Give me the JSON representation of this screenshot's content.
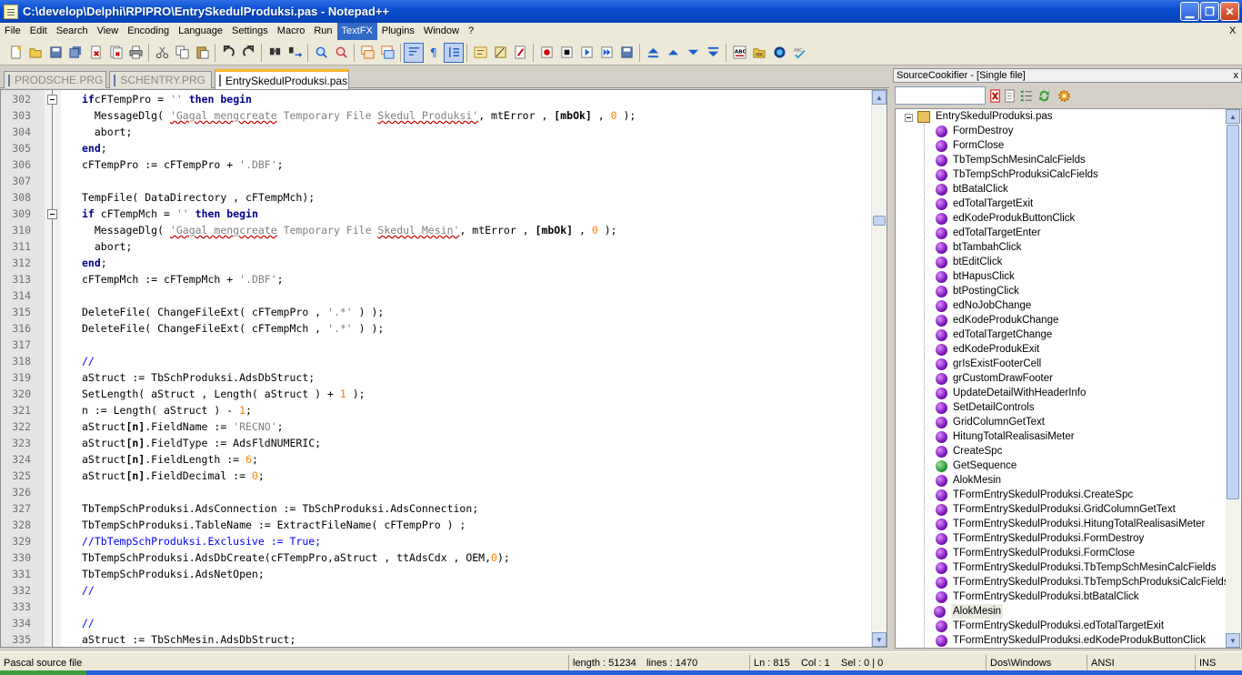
{
  "window": {
    "title": "C:\\develop\\Delphi\\RPIPRO\\EntrySkedulProduksi.pas - Notepad++",
    "minimize_glyph": "▁",
    "restore_glyph": "❐",
    "close_glyph": "✕"
  },
  "menu": {
    "items": [
      "File",
      "Edit",
      "Search",
      "View",
      "Encoding",
      "Language",
      "Settings",
      "Macro",
      "Run",
      "TextFX",
      "Plugins",
      "Window",
      "?"
    ],
    "active": "TextFX",
    "close_glyph": "X"
  },
  "toolbar": {
    "icons": [
      "new-file-icon",
      "open-file-icon",
      "save-icon",
      "save-all-icon",
      "close-icon",
      "close-all-icon",
      "print-icon",
      "cut-icon",
      "copy-icon",
      "paste-icon",
      "undo-icon",
      "redo-icon",
      "find-icon",
      "replace-icon",
      "zoom-in-icon",
      "zoom-out-icon",
      "sync-vertical-icon",
      "sync-horizontal-icon",
      "word-wrap-icon",
      "show-all-chars-icon",
      "indent-guide-icon",
      "user-lang-icon",
      "doc-map-icon",
      "function-list-icon",
      "record-macro-icon",
      "stop-macro-icon",
      "play-macro-icon",
      "run-macro-multiple-icon",
      "save-macro-icon",
      "bookmark-first-icon",
      "bookmark-prev-icon",
      "bookmark-next-icon",
      "bookmark-last-icon",
      "spell-check-icon",
      "spell-options-icon",
      "source-cookifier-icon",
      "spell-auto-icon"
    ]
  },
  "tabs": [
    {
      "label": "PRODSCHE.PRG",
      "active": false
    },
    {
      "label": "SCHENTRY.PRG",
      "active": false
    },
    {
      "label": "EntrySkedulProduksi.pas",
      "active": true
    }
  ],
  "editor": {
    "lines": [
      {
        "n": "302",
        "fold": true,
        "parts": [
          [
            "kw",
            "if"
          ],
          [
            "",
            "cFTempPro = "
          ],
          [
            "st",
            "''"
          ],
          [
            "kw",
            " then begin"
          ]
        ]
      },
      {
        "n": "303",
        "fold": false,
        "parts": [
          [
            "",
            "  MessageDlg( "
          ],
          [
            "st-u",
            "'Gagal mengcreate"
          ],
          [
            "st",
            " Temporary File "
          ],
          [
            "st-u",
            "Skedul Produksi'"
          ],
          [
            "",
            ", mtError , "
          ],
          [
            "sb",
            "[mbOk]"
          ],
          [
            "",
            " , "
          ],
          [
            "nm",
            "0"
          ],
          [
            "",
            " );"
          ]
        ]
      },
      {
        "n": "304",
        "fold": false,
        "parts": [
          [
            "",
            "  abort;"
          ]
        ]
      },
      {
        "n": "305",
        "fold": false,
        "parts": [
          [
            "kw",
            "end"
          ],
          [
            "",
            ";"
          ]
        ]
      },
      {
        "n": "306",
        "fold": false,
        "parts": [
          [
            "",
            "cFTempPro := cFTempPro + "
          ],
          [
            "st",
            "'.DBF'"
          ],
          [
            "",
            ";"
          ]
        ]
      },
      {
        "n": "307",
        "fold": false,
        "parts": [
          [
            "",
            ""
          ]
        ]
      },
      {
        "n": "308",
        "fold": false,
        "parts": [
          [
            "",
            "TempFile( DataDirectory , cFTempMch);"
          ]
        ]
      },
      {
        "n": "309",
        "fold": true,
        "parts": [
          [
            "kw",
            "if"
          ],
          [
            "",
            " cFTempMch = "
          ],
          [
            "st",
            "''"
          ],
          [
            "kw",
            " then begin"
          ]
        ]
      },
      {
        "n": "310",
        "fold": false,
        "parts": [
          [
            "",
            "  MessageDlg( "
          ],
          [
            "st-u",
            "'Gagal mengcreate"
          ],
          [
            "st",
            " Temporary File "
          ],
          [
            "st-u",
            "Skedul Mesin'"
          ],
          [
            "",
            ", mtError , "
          ],
          [
            "sb",
            "[mbOk]"
          ],
          [
            "",
            " , "
          ],
          [
            "nm",
            "0"
          ],
          [
            "",
            " );"
          ]
        ]
      },
      {
        "n": "311",
        "fold": false,
        "parts": [
          [
            "",
            "  abort;"
          ]
        ]
      },
      {
        "n": "312",
        "fold": false,
        "parts": [
          [
            "kw",
            "end"
          ],
          [
            "",
            ";"
          ]
        ]
      },
      {
        "n": "313",
        "fold": false,
        "parts": [
          [
            "",
            "cFTempMch := cFTempMch + "
          ],
          [
            "st",
            "'.DBF'"
          ],
          [
            "",
            ";"
          ]
        ]
      },
      {
        "n": "314",
        "fold": false,
        "parts": [
          [
            "",
            ""
          ]
        ]
      },
      {
        "n": "315",
        "fold": false,
        "parts": [
          [
            "",
            "DeleteFile( ChangeFileExt( cFTempPro , "
          ],
          [
            "st",
            "'.*'"
          ],
          [
            "",
            " ) );"
          ]
        ]
      },
      {
        "n": "316",
        "fold": false,
        "parts": [
          [
            "",
            "DeleteFile( ChangeFileExt( cFTempMch , "
          ],
          [
            "st",
            "'.*'"
          ],
          [
            "",
            " ) );"
          ]
        ]
      },
      {
        "n": "317",
        "fold": false,
        "parts": [
          [
            "",
            ""
          ]
        ]
      },
      {
        "n": "318",
        "fold": false,
        "parts": [
          [
            "cm",
            "//"
          ]
        ]
      },
      {
        "n": "319",
        "fold": false,
        "parts": [
          [
            "",
            "aStruct := TbSchProduksi.AdsDbStruct;"
          ]
        ]
      },
      {
        "n": "320",
        "fold": false,
        "parts": [
          [
            "",
            "SetLength( aStruct , Length( aStruct ) + "
          ],
          [
            "nm",
            "1"
          ],
          [
            "",
            " );"
          ]
        ]
      },
      {
        "n": "321",
        "fold": false,
        "parts": [
          [
            "",
            "n := Length( aStruct ) - "
          ],
          [
            "nm",
            "1"
          ],
          [
            "",
            ";"
          ]
        ]
      },
      {
        "n": "322",
        "fold": false,
        "parts": [
          [
            "",
            "aStruct"
          ],
          [
            "sb",
            "[n]"
          ],
          [
            "",
            ".FieldName := "
          ],
          [
            "st",
            "'RECNO'"
          ],
          [
            "",
            ";"
          ]
        ]
      },
      {
        "n": "323",
        "fold": false,
        "parts": [
          [
            "",
            "aStruct"
          ],
          [
            "sb",
            "[n]"
          ],
          [
            "",
            ".FieldType := AdsFldNUMERIC;"
          ]
        ]
      },
      {
        "n": "324",
        "fold": false,
        "parts": [
          [
            "",
            "aStruct"
          ],
          [
            "sb",
            "[n]"
          ],
          [
            "",
            ".FieldLength := "
          ],
          [
            "nm",
            "6"
          ],
          [
            "",
            ";"
          ]
        ]
      },
      {
        "n": "325",
        "fold": false,
        "parts": [
          [
            "",
            "aStruct"
          ],
          [
            "sb",
            "[n]"
          ],
          [
            "",
            ".FieldDecimal := "
          ],
          [
            "nm",
            "0"
          ],
          [
            "",
            ";"
          ]
        ]
      },
      {
        "n": "326",
        "fold": false,
        "parts": [
          [
            "",
            ""
          ]
        ]
      },
      {
        "n": "327",
        "fold": false,
        "parts": [
          [
            "",
            "TbTempSchProduksi.AdsConnection := TbSchProduksi.AdsConnection;"
          ]
        ]
      },
      {
        "n": "328",
        "fold": false,
        "parts": [
          [
            "",
            "TbTempSchProduksi.TableName := ExtractFileName( cFTempPro ) ;"
          ]
        ]
      },
      {
        "n": "329",
        "fold": false,
        "parts": [
          [
            "cm",
            "//TbTempSchProduksi.Exclusive := True;"
          ]
        ]
      },
      {
        "n": "330",
        "fold": false,
        "parts": [
          [
            "",
            "TbTempSchProduksi.AdsDbCreate(cFTempPro,aStruct , ttAdsCdx , OEM,"
          ],
          [
            "nm",
            "0"
          ],
          [
            "",
            ");"
          ]
        ]
      },
      {
        "n": "331",
        "fold": false,
        "parts": [
          [
            "",
            "TbTempSchProduksi.AdsNetOpen;"
          ]
        ]
      },
      {
        "n": "332",
        "fold": false,
        "parts": [
          [
            "cm",
            "//"
          ]
        ]
      },
      {
        "n": "333",
        "fold": false,
        "parts": [
          [
            "",
            ""
          ]
        ]
      },
      {
        "n": "334",
        "fold": false,
        "parts": [
          [
            "cm",
            "//"
          ]
        ]
      },
      {
        "n": "335",
        "fold": false,
        "parts": [
          [
            "",
            "aStruct := TbSchMesin.AdsDbStruct;"
          ]
        ]
      }
    ]
  },
  "source_cookifier": {
    "title": "SourceCookifier - [Single file]",
    "close_glyph": "x",
    "search_value": "",
    "root": "EntrySkedulProduksi.pas",
    "items": [
      {
        "label": "FormDestroy",
        "green": false
      },
      {
        "label": "FormClose",
        "green": false
      },
      {
        "label": "TbTempSchMesinCalcFields",
        "green": false
      },
      {
        "label": "TbTempSchProduksiCalcFields",
        "green": false
      },
      {
        "label": "btBatalClick",
        "green": false
      },
      {
        "label": "edTotalTargetExit",
        "green": false
      },
      {
        "label": "edKodeProdukButtonClick",
        "green": false
      },
      {
        "label": "edTotalTargetEnter",
        "green": false
      },
      {
        "label": "btTambahClick",
        "green": false
      },
      {
        "label": "btEditClick",
        "green": false
      },
      {
        "label": "btHapusClick",
        "green": false
      },
      {
        "label": "btPostingClick",
        "green": false
      },
      {
        "label": "edNoJobChange",
        "green": false
      },
      {
        "label": "edKodeProdukChange",
        "green": false
      },
      {
        "label": "edTotalTargetChange",
        "green": false
      },
      {
        "label": "edKodeProdukExit",
        "green": false
      },
      {
        "label": "grIsExistFooterCell",
        "green": false
      },
      {
        "label": "grCustomDrawFooter",
        "green": false
      },
      {
        "label": "UpdateDetailWithHeaderInfo",
        "green": false
      },
      {
        "label": "SetDetailControls",
        "green": false
      },
      {
        "label": "GridColumnGetText",
        "green": false
      },
      {
        "label": "HitungTotalRealisasiMeter",
        "green": false
      },
      {
        "label": "CreateSpc",
        "green": false
      },
      {
        "label": "GetSequence",
        "green": true
      },
      {
        "label": "AlokMesin",
        "green": false
      },
      {
        "label": "TFormEntrySkedulProduksi.CreateSpc",
        "green": false
      },
      {
        "label": "TFormEntrySkedulProduksi.GridColumnGetText",
        "green": false
      },
      {
        "label": "TFormEntrySkedulProduksi.HitungTotalRealisasiMeter",
        "green": false
      },
      {
        "label": "TFormEntrySkedulProduksi.FormDestroy",
        "green": false
      },
      {
        "label": "TFormEntrySkedulProduksi.FormClose",
        "green": false
      },
      {
        "label": "TFormEntrySkedulProduksi.TbTempSchMesinCalcFields",
        "green": false
      },
      {
        "label": "TFormEntrySkedulProduksi.TbTempSchProduksiCalcFields",
        "green": false
      },
      {
        "label": "TFormEntrySkedulProduksi.btBatalClick",
        "green": false
      },
      {
        "label": "AlokMesin",
        "green": false,
        "selected": true
      },
      {
        "label": "TFormEntrySkedulProduksi.edTotalTargetExit",
        "green": false
      },
      {
        "label": "TFormEntrySkedulProduksi.edKodeProdukButtonClick",
        "green": false
      }
    ]
  },
  "status": {
    "file_type": "Pascal source file",
    "length": "length : 51234",
    "lines": "lines : 1470",
    "position": "Ln : 815    Col : 1    Sel : 0 | 0",
    "eol": "Dos\\Windows",
    "encoding": "ANSI",
    "mode": "INS"
  },
  "colors": {
    "keyword": "#00008b",
    "string": "#808080",
    "number": "#ff8000",
    "comment": "#0000ff",
    "active_tab_accent": "#fab62d",
    "title_bar": "#0a4fd3"
  }
}
